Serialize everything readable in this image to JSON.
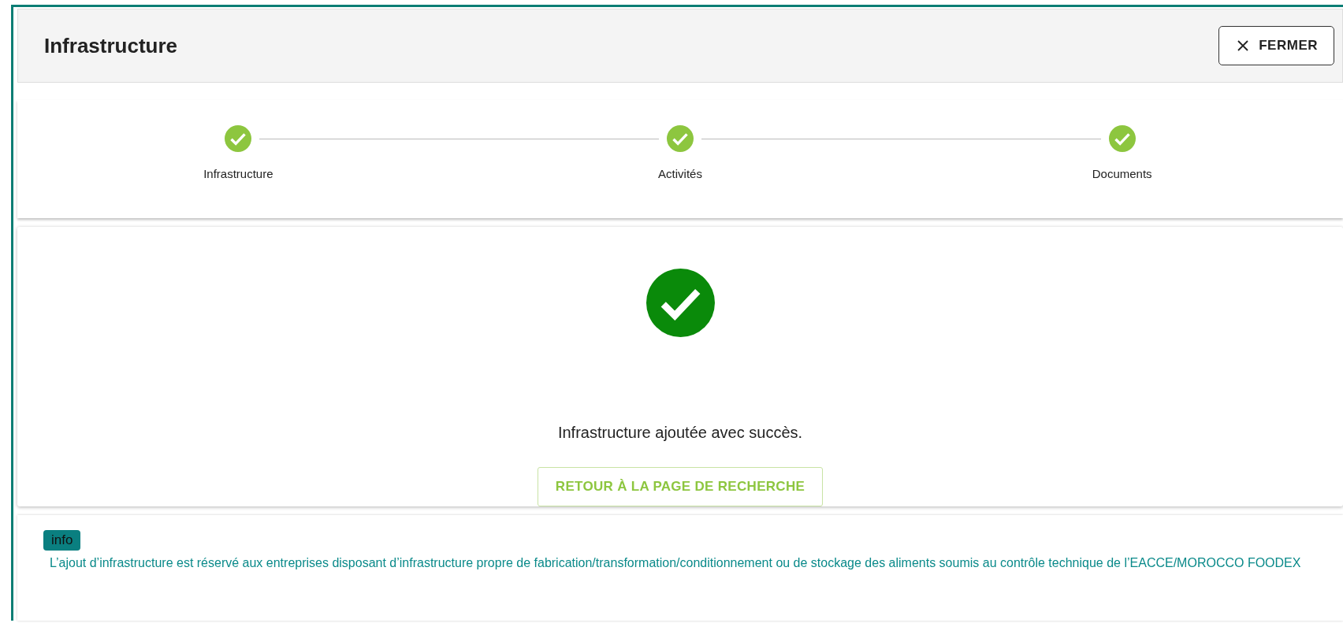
{
  "header": {
    "title": "Infrastructure",
    "close_button": "FERMER"
  },
  "steps": [
    {
      "label": "Infrastructure",
      "completed": true
    },
    {
      "label": "Activités",
      "completed": true
    },
    {
      "label": "Documents",
      "completed": true
    }
  ],
  "result": {
    "message": "Infrastructure ajoutée avec succès.",
    "button": "RETOUR À LA PAGE DE RECHERCHE"
  },
  "info": {
    "badge": "info",
    "text": "L’ajout d’infrastructure est réservé aux entreprises disposant d’infrastructure propre de fabrication/transformation/conditionnement ou de stockage des aliments soumis au contrôle technique de l’EACCE/MOROCCO FOODEX"
  }
}
